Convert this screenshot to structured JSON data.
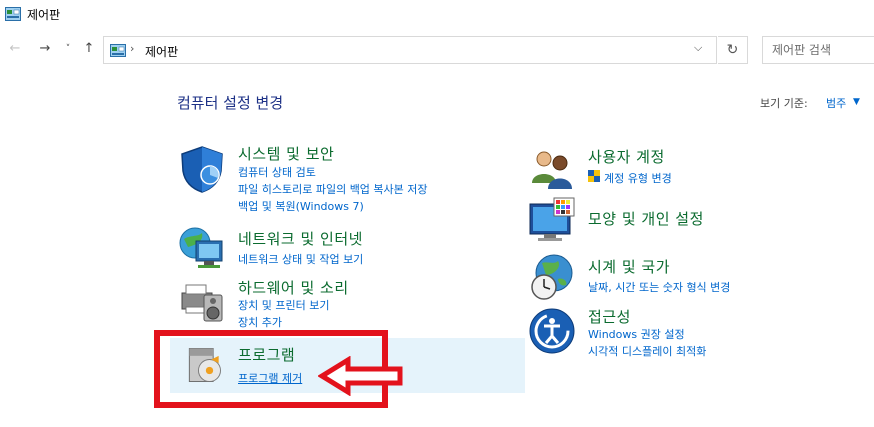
{
  "window": {
    "title": "제어판"
  },
  "navigation": {
    "back_glyph": "←",
    "forward_glyph": "→",
    "recent_glyph": "˅",
    "up_glyph": "↑",
    "separator": "›",
    "address_text": "제어판",
    "dropdown_glyph": "⌵",
    "refresh_glyph": "↻",
    "search_placeholder": "제어판 검색"
  },
  "header": {
    "heading": "컴퓨터 설정 변경",
    "view_by_label": "보기 기준:",
    "view_by_value": "범주",
    "view_by_arrow": "▼"
  },
  "categories": [
    {
      "title": "시스템 및 보안",
      "icon": "shield-icon",
      "links": [
        "컴퓨터 상태 검토",
        "파일 히스토리로 파일의 백업 복사본 저장",
        "백업 및 복원(Windows 7)"
      ]
    },
    {
      "title": "네트워크 및 인터넷",
      "icon": "network-globe-icon",
      "links": [
        "네트워크 상태 및 작업 보기"
      ]
    },
    {
      "title": "하드웨어 및 소리",
      "icon": "printer-speaker-icon",
      "links": [
        "장치 및 프린터 보기",
        "장치 추가"
      ]
    },
    {
      "title": "프로그램",
      "icon": "program-disc-icon",
      "links": [
        "프로그램 제거"
      ]
    },
    {
      "title": "사용자 계정",
      "icon": "users-icon",
      "links": [
        "계정 유형 변경"
      ]
    },
    {
      "title": "모양 및 개인 설정",
      "icon": "monitor-palette-icon",
      "links": []
    },
    {
      "title": "시계 및 국가",
      "icon": "clock-globe-icon",
      "links": [
        "날짜, 시간 또는 숫자 형식 변경"
      ]
    },
    {
      "title": "접근성",
      "icon": "accessibility-icon",
      "links": [
        "Windows 권장 설정",
        "시각적 디스플레이 최적화"
      ]
    }
  ],
  "colors": {
    "category_title": "#0b6b2f",
    "link": "#0066cc",
    "heading": "#1e3287",
    "highlight": "#e5f3fb",
    "annotation": "#e3121c"
  }
}
